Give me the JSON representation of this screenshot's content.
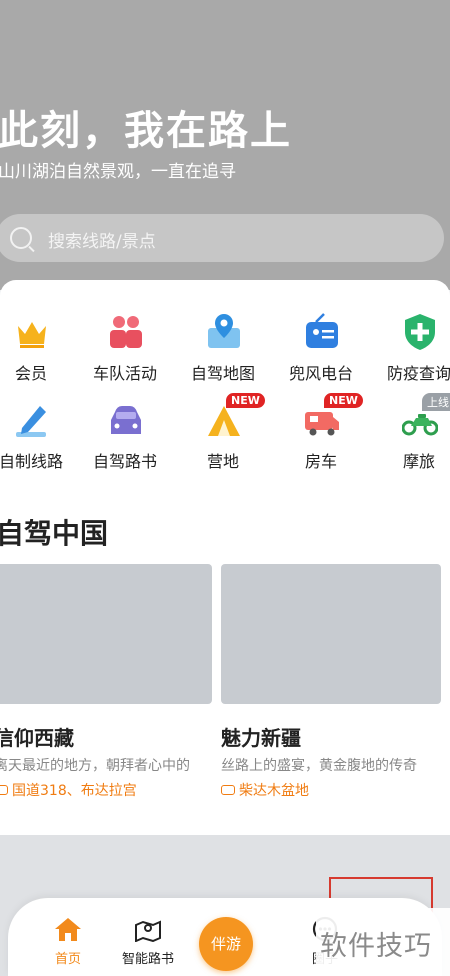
{
  "hero": {
    "title": "此刻，我在路上",
    "subtitle": "山川湖泊自然景观，一直在追寻",
    "search_placeholder": "搜索线路/景点"
  },
  "grid": [
    {
      "label": "会员",
      "icon": "crown-icon"
    },
    {
      "label": "车队活动",
      "icon": "group-icon"
    },
    {
      "label": "自驾地图",
      "icon": "map-icon"
    },
    {
      "label": "兜风电台",
      "icon": "radio-icon"
    },
    {
      "label": "防疫查询",
      "icon": "shield-plus-icon"
    },
    {
      "label": "自制线路",
      "icon": "pen-icon"
    },
    {
      "label": "自驾路书",
      "icon": "car-icon"
    },
    {
      "label": "营地",
      "icon": "tent-icon",
      "badge": "NEW"
    },
    {
      "label": "房车",
      "icon": "rv-icon",
      "badge": "NEW"
    },
    {
      "label": "摩旅",
      "icon": "motorcycle-icon",
      "badge": "上线中"
    }
  ],
  "section": {
    "title": "自驾中国",
    "destinations": [
      {
        "title": "信仰西藏",
        "desc": "离天最近的地方，朝拜者心中的",
        "tag": "国道318、布达拉宫"
      },
      {
        "title": "魅力新疆",
        "desc": "丝路上的盛宴，黄金腹地的传奇",
        "tag": "柴达木盆地"
      }
    ]
  },
  "tabbar": {
    "home": "首页",
    "roadbook": "智能路书",
    "center": "伴游",
    "circle": "圈子"
  },
  "watermark": "软件技巧",
  "colors": {
    "accent": "#f59520",
    "badge": "#e02424",
    "tag": "#f07c12"
  }
}
